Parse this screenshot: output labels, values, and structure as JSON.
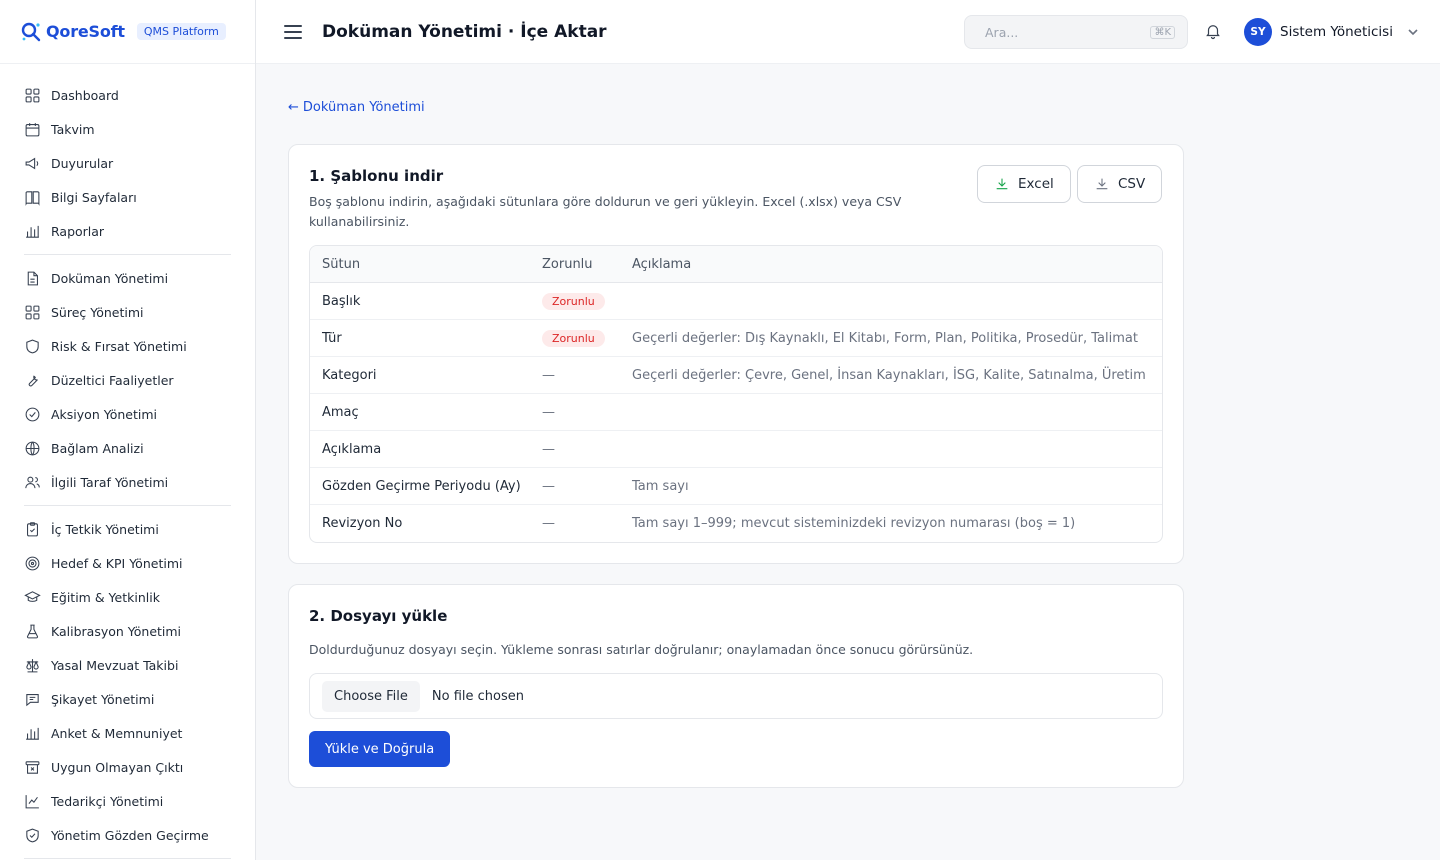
{
  "brand": {
    "name": "QoreSoft",
    "badge": "QMS Platform"
  },
  "header": {
    "title": "Doküman Yönetimi · İçe Aktar",
    "search_placeholder": "Ara...",
    "search_shortcut": "⌘K",
    "user_initials": "SY",
    "user_name": "Sistem Yöneticisi"
  },
  "sidebar": {
    "group1": [
      {
        "label": "Dashboard",
        "icon": "dashboard-icon"
      },
      {
        "label": "Takvim",
        "icon": "calendar-icon"
      },
      {
        "label": "Duyurular",
        "icon": "megaphone-icon"
      },
      {
        "label": "Bilgi Sayfaları",
        "icon": "book-icon"
      },
      {
        "label": "Raporlar",
        "icon": "bar-chart-icon"
      }
    ],
    "group2": [
      {
        "label": "Doküman Yönetimi",
        "icon": "document-icon"
      },
      {
        "label": "Süreç Yönetimi",
        "icon": "grid-icon"
      },
      {
        "label": "Risk & Fırsat Yönetimi",
        "icon": "shield-icon"
      },
      {
        "label": "Düzeltici Faaliyetler",
        "icon": "wrench-icon"
      },
      {
        "label": "Aksiyon Yönetimi",
        "icon": "check-circle-icon"
      },
      {
        "label": "Bağlam Analizi",
        "icon": "globe-icon"
      },
      {
        "label": "İlgili Taraf Yönetimi",
        "icon": "users-icon"
      }
    ],
    "group3": [
      {
        "label": "İç Tetkik Yönetimi",
        "icon": "clipboard-icon"
      },
      {
        "label": "Hedef & KPI Yönetimi",
        "icon": "target-icon"
      },
      {
        "label": "Eğitim & Yetkinlik",
        "icon": "graduation-cap-icon"
      },
      {
        "label": "Kalibrasyon Yönetimi",
        "icon": "flask-icon"
      },
      {
        "label": "Yasal Mevzuat Takibi",
        "icon": "scale-icon"
      },
      {
        "label": "Şikayet Yönetimi",
        "icon": "message-icon"
      },
      {
        "label": "Anket & Memnuniyet",
        "icon": "bar-chart-icon"
      },
      {
        "label": "Uygun Olmayan Çıktı",
        "icon": "archive-x-icon"
      },
      {
        "label": "Tedarikçi Yönetimi",
        "icon": "line-chart-icon"
      },
      {
        "label": "Yönetim Gözden Geçirme",
        "icon": "shield-check-icon"
      }
    ]
  },
  "main": {
    "back_link": "Doküman Yönetimi",
    "step1": {
      "title": "1. Şablonu indir",
      "description": "Boş şablonu indirin, aşağıdaki sütunlara göre doldurun ve geri yükleyin. Excel (.xlsx) veya CSV kullanabilirsiniz.",
      "excel_label": "Excel",
      "csv_label": "CSV",
      "table": {
        "headers": [
          "Sütun",
          "Zorunlu",
          "Açıklama"
        ],
        "rows": [
          {
            "column": "Başlık",
            "required": "Zorunlu",
            "desc": ""
          },
          {
            "column": "Tür",
            "required": "Zorunlu",
            "desc": "Geçerli değerler: Dış Kaynaklı, El Kitabı, Form, Plan, Politika, Prosedür, Talimat"
          },
          {
            "column": "Kategori",
            "required": "—",
            "desc": "Geçerli değerler: Çevre, Genel, İnsan Kaynakları, İSG, Kalite, Satınalma, Üretim"
          },
          {
            "column": "Amaç",
            "required": "—",
            "desc": ""
          },
          {
            "column": "Açıklama",
            "required": "—",
            "desc": ""
          },
          {
            "column": "Gözden Geçirme Periyodu (Ay)",
            "required": "—",
            "desc": "Tam sayı"
          },
          {
            "column": "Revizyon No",
            "required": "—",
            "desc": "Tam sayı 1–999; mevcut sisteminizdeki revizyon numarası (boş = 1)"
          }
        ]
      }
    },
    "step2": {
      "title": "2. Dosyayı yükle",
      "description": "Doldurduğunuz dosyayı seçin. Yükleme sonrası satırlar doğrulanır; onaylamadan önce sonucu görürsünüz.",
      "choose_file": "Choose File",
      "no_file": "No file chosen",
      "submit_label": "Yükle ve Doğrula"
    }
  },
  "colors": {
    "accent": "#1d4ed8",
    "required_bg": "#fdeaea",
    "required_text": "#dc2626",
    "excel_icon": "#16a34a",
    "csv_icon": "#6b7280"
  }
}
